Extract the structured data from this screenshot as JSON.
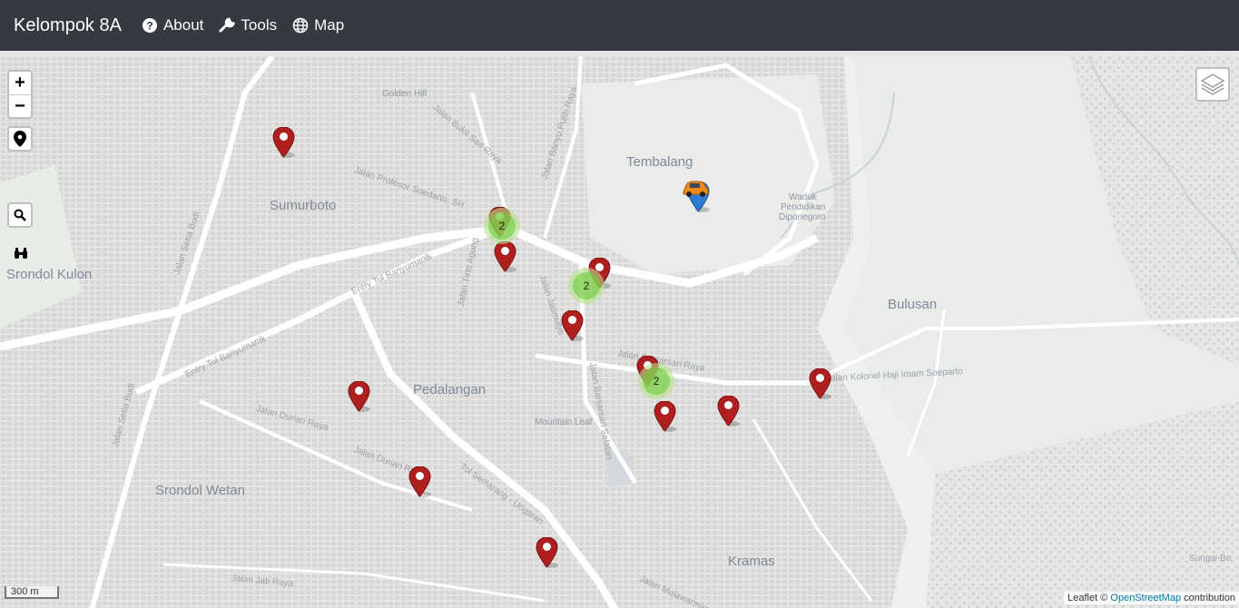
{
  "navbar": {
    "brand": "Kelompok 8A",
    "items": [
      {
        "label": "About",
        "icon": "question-circle-icon"
      },
      {
        "label": "Tools",
        "icon": "wrench-icon"
      },
      {
        "label": "Map",
        "icon": "globe-icon"
      }
    ]
  },
  "map": {
    "controls": {
      "zoom_in": "+",
      "zoom_out": "−"
    },
    "places": [
      "Tembalang",
      "Sumurboto",
      "Srondol Kulon",
      "Bulusan",
      "Pedalangan",
      "Srondol Wetan",
      "Kramas"
    ],
    "small_labels": [
      "Golden Hill",
      "Waduk",
      "Pendidikan",
      "Diponegoro",
      "Mountain Leaf"
    ],
    "streets": [
      "Jalan Bukit Sari Raya",
      "Jalan Banyu Putih Raya",
      "Jalan Profesor Soedarto, SH",
      "Entry Tol Banyumanik",
      "Entry Tol Banyumanik",
      "Jalan Setia Budi",
      "Jalan Setia Budi",
      "Jalan Tirto Agung",
      "Jalan Jatimulyo",
      "Jalan Banjarsari Raya",
      "Jalan Banjarsari Selatan",
      "Jalan Durian Raya",
      "Jalan Durian Raya",
      "Tol Semarang - Ungaran",
      "Jalan Kolonel Haji Imam Soeparto",
      "Jalan Jati Raya",
      "Jalan Mulawarman",
      "Sungai Bo"
    ],
    "clusters": [
      "2",
      "2",
      "2"
    ],
    "markers_count": 12,
    "scale": "300 m",
    "attribution": {
      "prefix": "Leaflet ©",
      "link": "OpenStreetMap",
      "suffix": " contribution"
    },
    "marker_color": "#b01f1f",
    "user_marker_color": "#2d7bd6"
  }
}
